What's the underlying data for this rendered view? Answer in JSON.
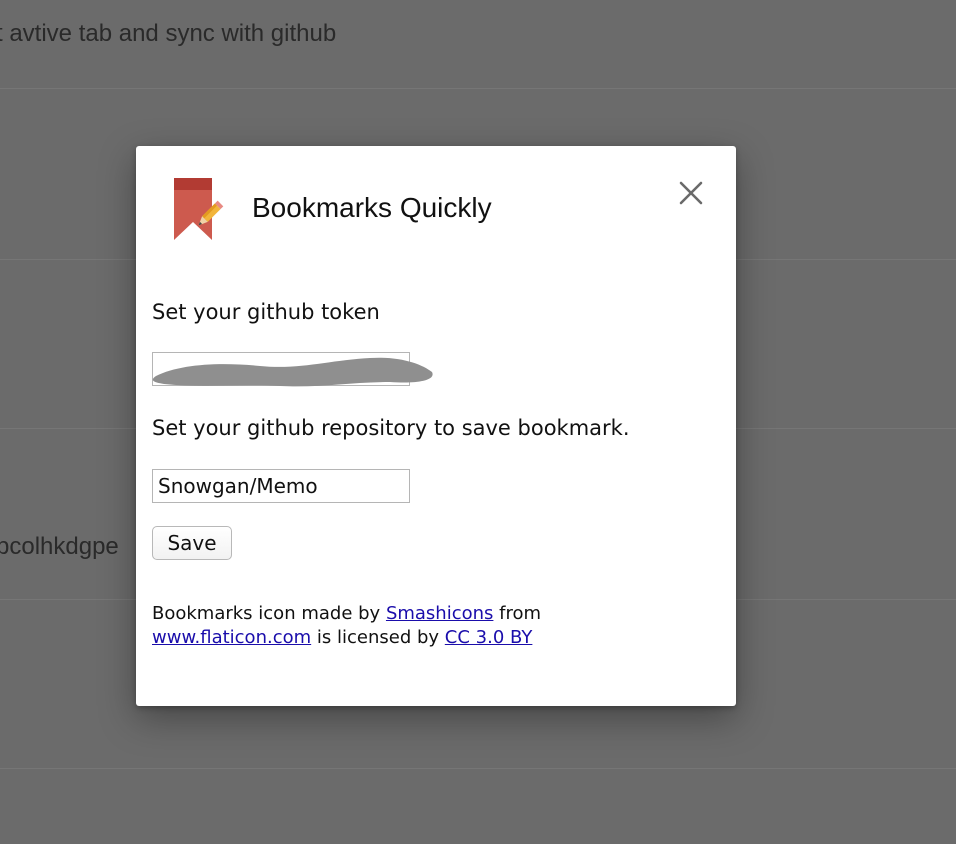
{
  "background": {
    "row_texts": [
      "t avtive tab and sync with github",
      "pcolhkdgpe"
    ]
  },
  "dialog": {
    "title": "Bookmarks Quickly",
    "icon": "bookmark-pencil-icon",
    "close_icon": "close-icon",
    "token": {
      "label": "Set your github token",
      "value": "",
      "redacted": true
    },
    "repo": {
      "label": "Set your github repository to save bookmark.",
      "value": "Snowgan/Memo"
    },
    "save_label": "Save",
    "credits": {
      "prefix": "Bookmarks icon made by",
      "author_link": "Smashicons",
      "middle": "from",
      "site_link": "www.flaticon.com",
      "license_text": "is licensed by",
      "license_link": "CC 3.0 BY"
    }
  },
  "colors": {
    "overlay": "#6b6b6b",
    "link": "#1a0dab",
    "icon_red": "#cd5a4e",
    "icon_dark_red": "#b23b33",
    "redaction_gray": "#8f8f8f"
  }
}
